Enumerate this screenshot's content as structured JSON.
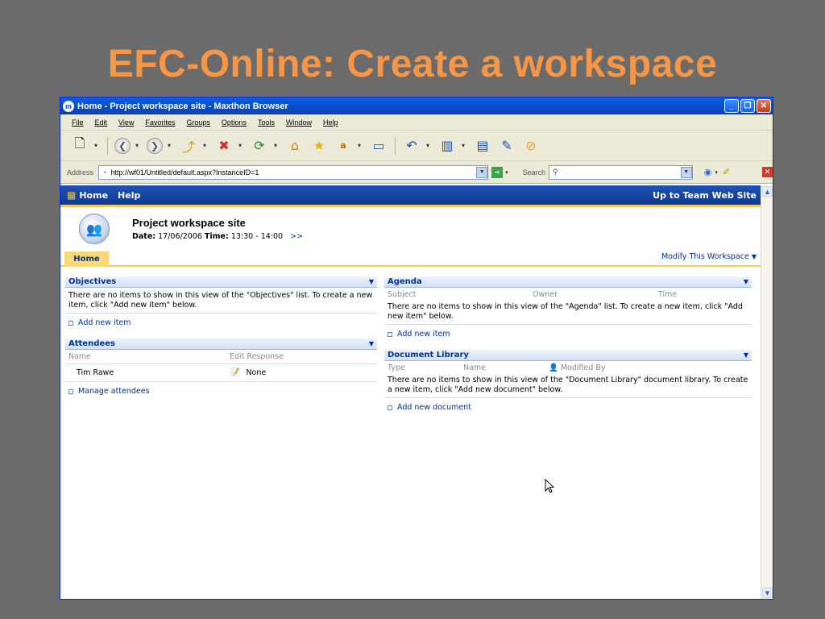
{
  "slide": {
    "title": "EFC-Online: Create a workspace"
  },
  "browser": {
    "title": "Home - Project workspace site - Maxthon Browser",
    "menu": [
      "File",
      "Edit",
      "View",
      "Favorites",
      "Groups",
      "Options",
      "Tools",
      "Window",
      "Help"
    ],
    "address_label": "Address",
    "url": "http://wf01/Untitled/default.aspx?InstanceID=1",
    "search_label": "Search",
    "search_value": ""
  },
  "site": {
    "nav": {
      "home": "Home",
      "help": "Help",
      "up": "Up to Team Web Site"
    },
    "workspace": {
      "title": "Project workspace site",
      "date_label": "Date:",
      "date": "17/06/2006",
      "time_label": "Time:",
      "time": "13:30 - 14:00",
      "more": ">>"
    },
    "tabs": {
      "home": "Home",
      "modify": "Modify This Workspace"
    },
    "objectives": {
      "title": "Objectives",
      "empty": "There are no items to show in this view of the \"Objectives\" list. To create a new item, click \"Add new item\" below.",
      "add": "Add new item"
    },
    "attendees": {
      "title": "Attendees",
      "columns": [
        "Name",
        "Edit Response"
      ],
      "rows": [
        {
          "name": "Tim Rawe",
          "response": "None"
        }
      ],
      "manage": "Manage attendees"
    },
    "agenda": {
      "title": "Agenda",
      "columns": [
        "Subject",
        "Owner",
        "Time"
      ],
      "empty": "There are no items to show in this view of the \"Agenda\" list. To create a new item, click \"Add new item\" below.",
      "add": "Add new item"
    },
    "doclib": {
      "title": "Document Library",
      "columns": [
        "Type",
        "Name",
        "Modified By"
      ],
      "empty": "There are no items to show in this view of the \"Document Library\" document library. To create a new item, click \"Add new document\" below.",
      "add": "Add new document"
    }
  },
  "colors": {
    "title_orange": "#f79646",
    "sp_blue": "#0e3a93",
    "link_blue": "#003399",
    "tab_gold": "#f9d87a"
  }
}
